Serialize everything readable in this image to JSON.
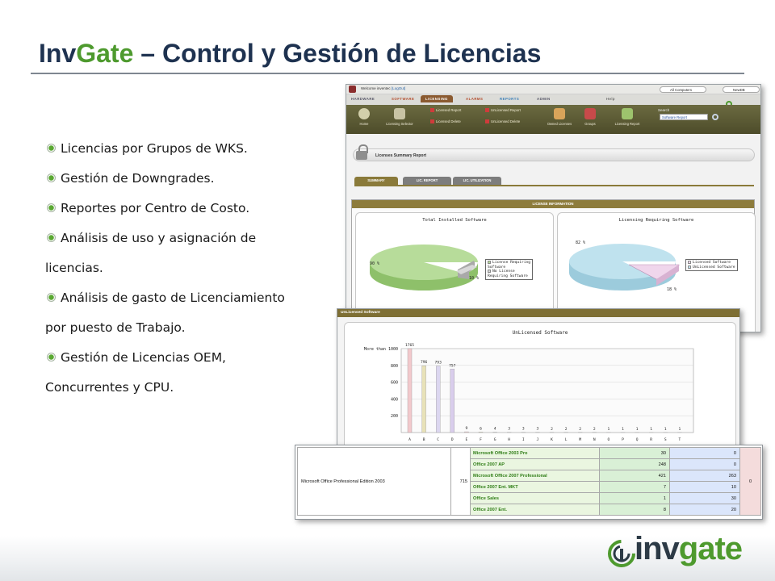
{
  "slide": {
    "title_brand_inv": "Inv",
    "title_brand_gate": "Gate",
    "title_rest": " – Control y Gestión de Licencias",
    "bullets": [
      "Licencias por Grupos de WKS.",
      "Gestión de Downgrades.",
      "Reportes por Centro de Costo.",
      "Análisis de uso y asignación de",
      "licencias.",
      "Análisis de gasto de Licenciamiento",
      "por puesto de Trabajo.",
      "Gestión de Licencias OEM,",
      "Concurrentes y CPU."
    ]
  },
  "app": {
    "welcome": "Welcome inventec",
    "logout": "[LogOut]",
    "computers_combo": "All Computers",
    "db_combo": "NewDB",
    "tabs": [
      "HARDWARE",
      "SOFTWARE",
      "LICENSING",
      "ALARMS",
      "REPORTS",
      "ADMIN",
      "Help"
    ],
    "logo": "invgate",
    "toolbar": {
      "home": "Home",
      "licensing_selector": "Licensing Selector",
      "licensed_report": "Licensed Report",
      "licensed_delete": "Licensed Delete",
      "unlicensed_report": "UnLicensed Report",
      "unlicensed_delete": "UnLicensed Delete",
      "owned_licenses": "Owned Licenses",
      "groups": "Groups",
      "licensing_report": "Licensing Report"
    },
    "search_label": "Search",
    "search_select": "Software Report",
    "report_title": "Licenses Summary Report",
    "subtabs": [
      "SUMMARY",
      "LIC. REPORT",
      "LIC. UTILIZATION"
    ],
    "info_title": "LICENSE INFORMATION"
  },
  "pies": [
    {
      "title": "Total Installed Software",
      "main_label": "90 %",
      "minor_label": "10 %",
      "legend": [
        "License Requiring\nSoftware",
        "No License\nRequiring Software"
      ],
      "colors": [
        "#b7dc9a",
        "#d8d8d8"
      ]
    },
    {
      "title": "Licensing Requiring Software",
      "main_label": "82 %",
      "minor_label": "18 %",
      "legend": [
        "Licensed Software",
        "UnLicensed Software"
      ],
      "colors": [
        "#f0d6ec",
        "#bfe2ee"
      ]
    }
  ],
  "unlicensed": {
    "header": "UnLicensed Software",
    "ticks": [
      "More than 1000",
      "800",
      "600",
      "400",
      "200"
    ]
  },
  "chart_data": {
    "type": "bar",
    "title": "UnLicensed Software",
    "categories": [
      "A",
      "B",
      "C",
      "D",
      "E",
      "F",
      "G",
      "H",
      "I",
      "J",
      "K",
      "L",
      "M",
      "N",
      "O",
      "P",
      "Q",
      "R",
      "S",
      "T"
    ],
    "values": [
      1765,
      796,
      793,
      757,
      9,
      6,
      4,
      3,
      3,
      3,
      2,
      2,
      2,
      2,
      1,
      1,
      1,
      1,
      1,
      1
    ],
    "colors": [
      "#f2c9cc",
      "#e8e2b8",
      "#dcd7f0",
      "#d9cdec"
    ],
    "ylim": [
      0,
      1000
    ]
  },
  "table": {
    "product": "Microsoft Office Professional Edition 2003",
    "total": "715",
    "rows": [
      {
        "name": "Microsoft Office 2003 Pro",
        "a": "30",
        "b": "0"
      },
      {
        "name": "Office 2007 AP",
        "a": "248",
        "b": "0"
      },
      {
        "name": "Microsoft Office 2007 Professional",
        "a": "421",
        "b": "263"
      },
      {
        "name": "Office 2007 Ent. MKT",
        "a": "7",
        "b": "10"
      },
      {
        "name": "Office Sales",
        "a": "1",
        "b": "30"
      },
      {
        "name": "Office 2007 Ent.",
        "a": "8",
        "b": "20"
      }
    ],
    "last": "0"
  },
  "footer": {
    "logo_inv": "inv",
    "logo_gate": "gate"
  }
}
